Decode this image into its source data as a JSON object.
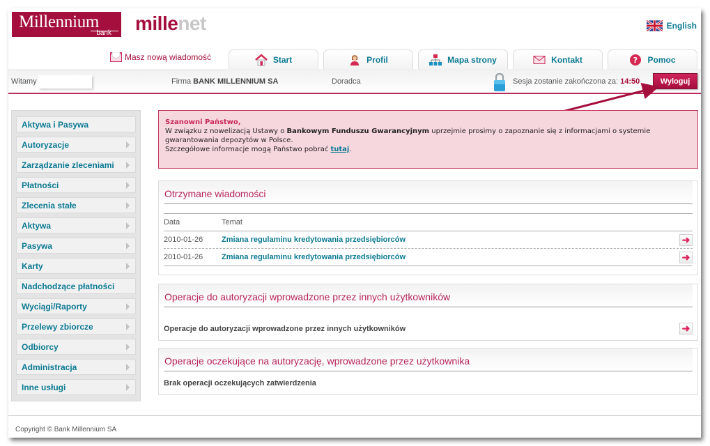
{
  "header": {
    "logo_main": "Millennium",
    "logo_sub": "bank",
    "product_part1": "mille",
    "product_part2": "net",
    "language_link": "English",
    "new_message": "Masz nową wiadomość"
  },
  "tabs": [
    {
      "label": "Start",
      "icon": "home-icon"
    },
    {
      "label": "Profil",
      "icon": "user-icon"
    },
    {
      "label": "Mapa strony",
      "icon": "sitemap-icon"
    },
    {
      "label": "Kontakt",
      "icon": "envelope-icon"
    },
    {
      "label": "Pomoc",
      "icon": "help-icon"
    }
  ],
  "userbar": {
    "welcome_label": "Witamy",
    "welcome_value": "",
    "firma_label": "Firma",
    "firma_value": "BANK MILLENNIUM SA",
    "advisor_label": "Doradca",
    "session_label": "Sesja zostanie zakończona za:",
    "session_time": "14:50",
    "logout_label": "Wyloguj"
  },
  "sidebar": {
    "items": [
      {
        "label": "Aktywa i Pasywa",
        "submenu": false
      },
      {
        "label": "Autoryzacje",
        "submenu": true
      },
      {
        "label": "Zarządzanie zleceniami",
        "submenu": true
      },
      {
        "label": "Płatności",
        "submenu": true
      },
      {
        "label": "Zlecenia stałe",
        "submenu": true
      },
      {
        "label": "Aktywa",
        "submenu": true
      },
      {
        "label": "Pasywa",
        "submenu": true
      },
      {
        "label": "Karty",
        "submenu": true
      },
      {
        "label": "Nadchodzące płatności",
        "submenu": false
      },
      {
        "label": "Wyciągi/Raporty",
        "submenu": true
      },
      {
        "label": "Przelewy zbiorcze",
        "submenu": true
      },
      {
        "label": "Odbiorcy",
        "submenu": true
      },
      {
        "label": "Administracja",
        "submenu": true
      },
      {
        "label": "Inne usługi",
        "submenu": true
      }
    ]
  },
  "notice": {
    "title": "Szanowni Państwo,",
    "line1_pre": "W związku z nowelizacją Ustawy o ",
    "line1_bold": "Bankowym Funduszu Gwarancyjnym",
    "line1_post": " uprzejmie prosimy o zapoznanie się z informacjami o systemie gwarantowania depozytów w Polsce.",
    "line2_pre": "Szczegółowe informacje mogą Państwo pobrać ",
    "link": "tutaj",
    "line2_post": "."
  },
  "messages": {
    "title": "Otrzymane wiadomości",
    "col_date": "Data",
    "col_topic": "Temat",
    "rows": [
      {
        "date": "2010-01-26",
        "topic": "Zmiana regulaminu kredytowania przedsiębiorców"
      },
      {
        "date": "2010-01-26",
        "topic": "Zmiana regulaminu kredytowania przedsiębiorców"
      }
    ]
  },
  "auth_others": {
    "title": "Operacje do autoryzacji wprowadzone przez innych użytkowników",
    "row": "Operacje do autoryzacji wprowadzone przez innych użytkowników"
  },
  "auth_pending": {
    "title": "Operacje oczekujące na autoryzację, wprowadzone przez użytkownika",
    "row": "Brak operacji oczekujących zatwierdzenia"
  },
  "footer": {
    "copyright": "Copyright © Bank Millennium SA"
  },
  "colors": {
    "brand": "#a50f3d",
    "link": "#0b7a93",
    "notice_bg": "#f7d7de"
  }
}
